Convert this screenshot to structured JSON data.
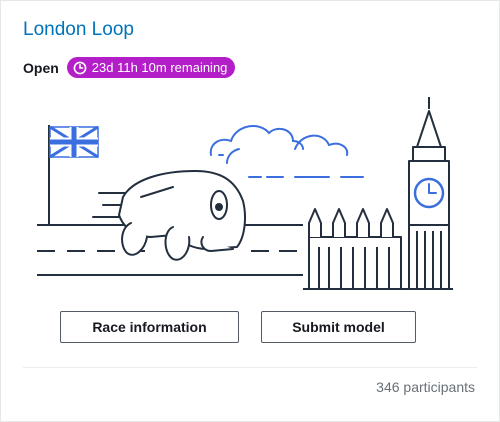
{
  "card": {
    "title": "London Loop",
    "status": "Open",
    "time_remaining": "23d 11h 10m remaining",
    "clock_icon": "clock-icon",
    "illustration": {
      "elements": [
        "uk-flag",
        "race-car",
        "clouds",
        "road",
        "parliament",
        "big-ben"
      ],
      "colors": {
        "stroke": "#232f3e",
        "accent": "#3b6fe0"
      }
    },
    "buttons": {
      "race_info": "Race information",
      "submit_model": "Submit model"
    },
    "participants": "346 participants",
    "colors": {
      "title": "#0073bb",
      "badge": "#b31ec8"
    }
  }
}
